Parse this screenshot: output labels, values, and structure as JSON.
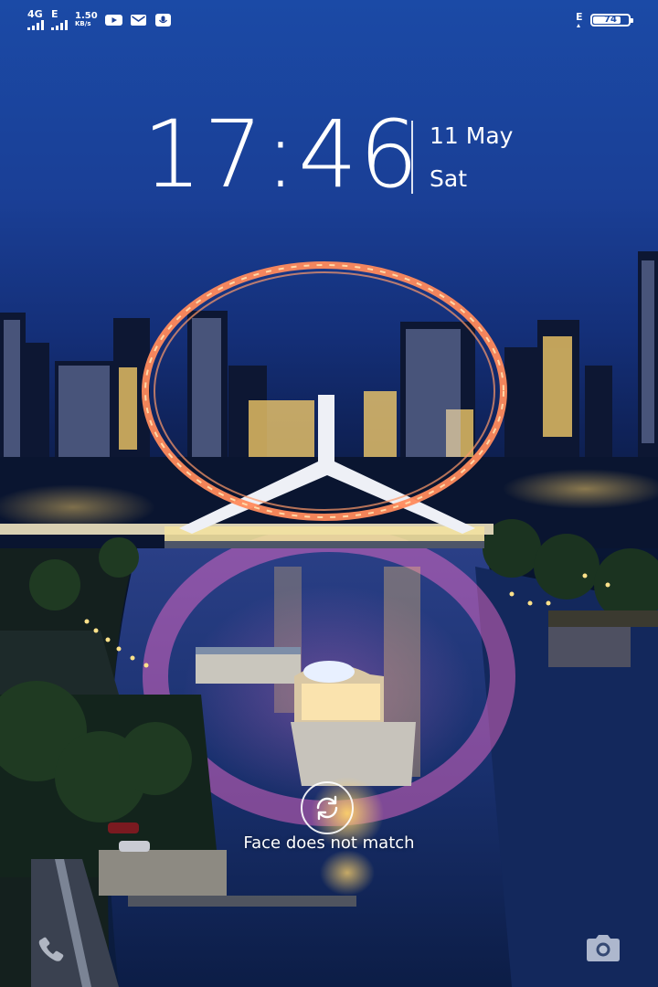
{
  "status_bar": {
    "network_1": "4G",
    "network_2": "E",
    "speed_value": "1.50",
    "speed_unit": "KB/s",
    "notification_icons": [
      "youtube-icon",
      "mail-icon",
      "voice-recorder-icon"
    ],
    "right_indicator": "E",
    "battery_level": "74"
  },
  "lock_screen": {
    "time": "17:46",
    "date": "11 May",
    "weekday": "Sat",
    "face_unlock_message": "Face does not match"
  },
  "shortcuts": {
    "left_icon": "phone-icon",
    "right_icon": "camera-icon"
  }
}
